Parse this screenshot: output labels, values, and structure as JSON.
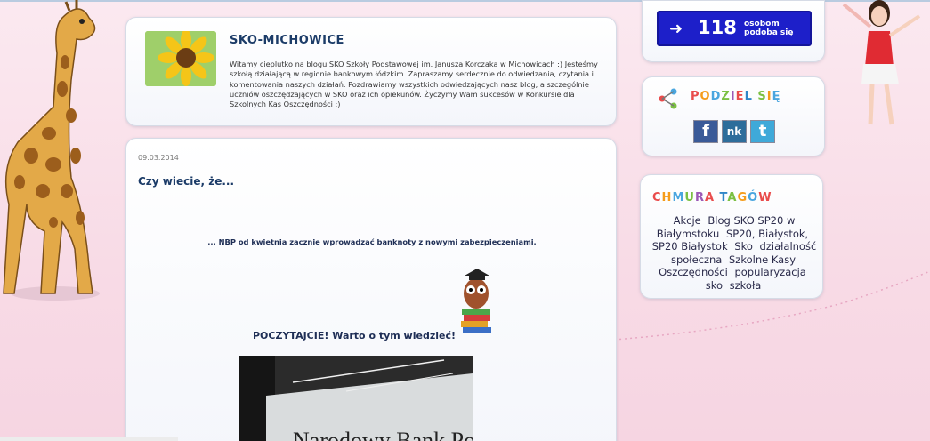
{
  "blog": {
    "title": "SKO-MICHOWICE",
    "description": "Witamy cieplutko na blogu SKO Szkoły Podstawowej im. Janusza Korczaka w Michowicach :) Jesteśmy szkołą działającą w regionie bankowym łódzkim. Zapraszamy serdecznie do odwiedzania, czytania i komentowania naszych działań. Pozdrawiamy wszystkich odwiedzających nasz blog, a szczególnie uczniów oszczędzających w SKO oraz ich opiekunów. Życzymy Wam sukcesów w Konkursie dla Szkolnych Kas Oszczędności :)"
  },
  "post": {
    "date": "09.03.2014",
    "title": "Czy wiecie, że...",
    "line1": "... NBP od kwietnia zacznie wprowadzać banknoty z nowymi zabezpieczeniami.",
    "line2": "POCZYTAJCIE! Warto o tym wiedzieć!",
    "photo_text": "Narodowy Bank Polski"
  },
  "like_box": {
    "count": "118",
    "text_line1": "osobom",
    "text_line2": "podoba się",
    "color": "#1d1fc9"
  },
  "share_box": {
    "title": "PODZIEL SIĘ",
    "buttons": [
      {
        "name": "facebook",
        "label": "f"
      },
      {
        "name": "nasza-klasa",
        "label": "nk"
      },
      {
        "name": "twitter",
        "label": "t"
      }
    ]
  },
  "tags_box": {
    "title": "CHMURA TAGÓW",
    "tags": [
      "Akcje",
      "Blog SKO SP20 w Białymstoku",
      "SP20, Białystok,",
      "SP20 Białystok",
      "Sko",
      "działalność społeczna",
      "Szkolne Kasy Oszczędności",
      "popularyzacja",
      "sko",
      "szkoła"
    ]
  }
}
